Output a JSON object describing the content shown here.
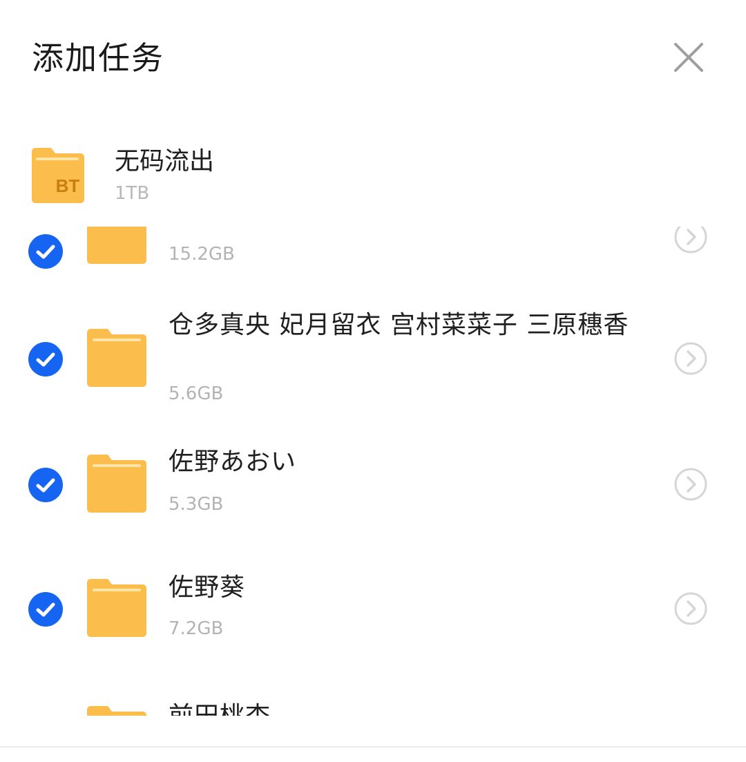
{
  "header": {
    "title": "添加任务",
    "close_icon": "close-icon"
  },
  "parent_folder": {
    "name": "无码流出",
    "size": "1TB",
    "badge": "BT",
    "icon": "bt-folder-icon"
  },
  "items": [
    {
      "name": "",
      "size": "15.2GB",
      "checked": true
    },
    {
      "name": "仓多真央 妃月留衣 宫村菜菜子 三原穗香",
      "size": "5.6GB",
      "checked": true
    },
    {
      "name": "佐野あおい",
      "size": "5.3GB",
      "checked": true
    },
    {
      "name": "佐野葵",
      "size": "7.2GB",
      "checked": true
    },
    {
      "name": "前田桃杏",
      "size": "",
      "checked": false
    }
  ],
  "colors": {
    "accent": "#1565f2",
    "folder": "#fbbd4c",
    "folder_light": "#ffe6a8",
    "chevron": "#d6d6d6",
    "text_secondary": "#b3b3b3"
  }
}
